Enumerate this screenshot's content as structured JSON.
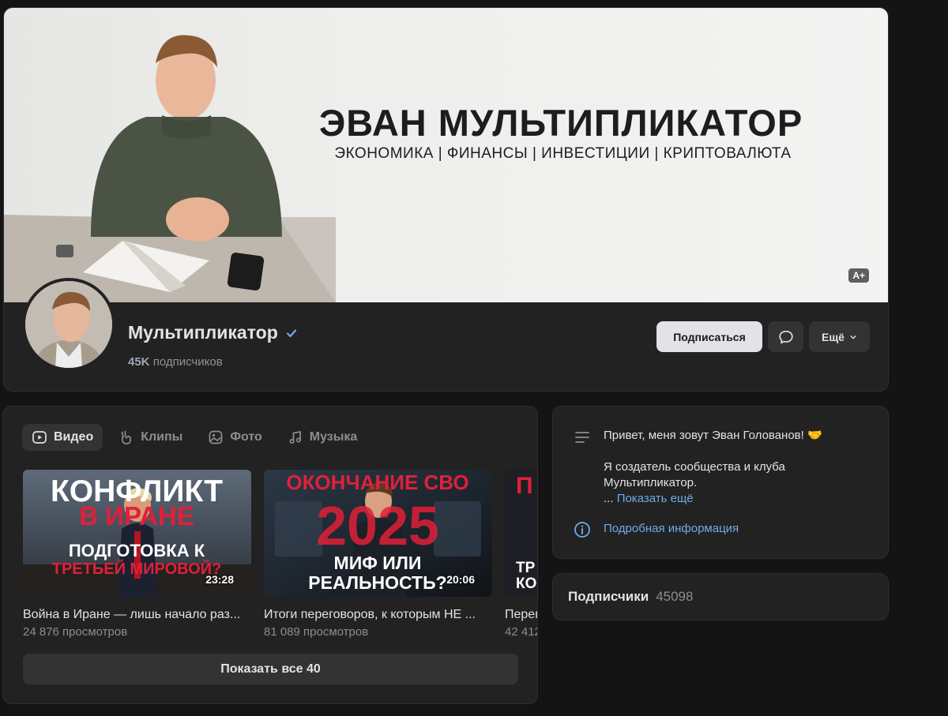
{
  "cover": {
    "title": "ЭВАН МУЛЬТИПЛИКАТОР",
    "subtitle": "ЭКОНОМИКА | ФИНАНСЫ | ИНВЕСТИЦИИ | КРИПТОВАЛЮТА",
    "age_rating": "A+"
  },
  "group": {
    "name": "Мультипликатор",
    "subscribers_short": "45K",
    "subscribers_word": "подписчиков"
  },
  "actions": {
    "subscribe_label": "Подписаться",
    "more_label": "Ещё"
  },
  "tabs": [
    {
      "label": "Видео",
      "icon": "play-icon",
      "active": true
    },
    {
      "label": "Клипы",
      "icon": "clip-icon",
      "active": false
    },
    {
      "label": "Фото",
      "icon": "photo-icon",
      "active": false
    },
    {
      "label": "Музыка",
      "icon": "music-icon",
      "active": false
    }
  ],
  "videos": [
    {
      "title": "Война в Иране — лишь начало раз...",
      "views": "24 876 просмотров",
      "duration": "23:28",
      "thumb_lines": [
        "КОНФЛИКТ",
        "В ИРАНЕ",
        "ПОДГОТОВКА К",
        "ТРЕТЬЕЙ МИРОВОЙ?"
      ]
    },
    {
      "title": "Итоги переговоров, к которым НЕ ...",
      "views": "81 089 просмотров",
      "duration": "20:06",
      "thumb_lines": [
        "ОКОНЧАНИЕ СВО",
        "2025",
        "МИФ ИЛИ",
        "РЕАЛЬНОСТЬ?"
      ]
    },
    {
      "title": "Перег",
      "views": "42 412",
      "duration": "",
      "thumb_lines": [
        "П",
        "ТР",
        "КО"
      ]
    }
  ],
  "show_all_label": "Показать все 40",
  "about": {
    "line1": "Привет, меня зовут Эван Голованов! 🤝",
    "line2": "Я создатель сообщества и клуба Мультипликатор.",
    "ellipsis": "...",
    "show_more": "Показать ещё",
    "details_link": "Подробная информация"
  },
  "subscribers": {
    "label": "Подписчики",
    "count": "45098"
  },
  "colors": {
    "accent_link": "#71aaeb",
    "card_bg": "#222222",
    "page_bg": "#141414",
    "thumb_red": "#e0203a"
  }
}
